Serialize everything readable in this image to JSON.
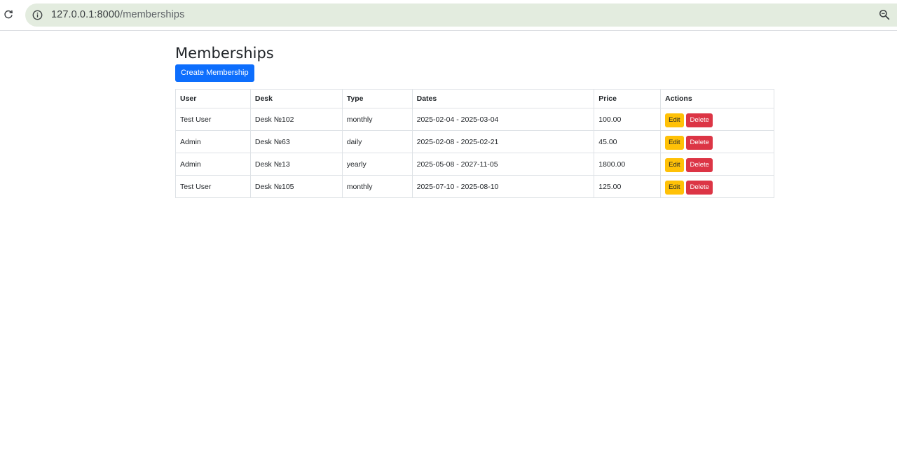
{
  "browser": {
    "url_host": "127.0.0.1:8000",
    "url_path": "/memberships"
  },
  "page": {
    "title": "Memberships",
    "create_label": "Create Membership"
  },
  "table": {
    "headers": [
      "User",
      "Desk",
      "Type",
      "Dates",
      "Price",
      "Actions"
    ],
    "rows": [
      {
        "user": "Test User",
        "desk": "Desk №102",
        "type": "monthly",
        "dates": "2025-02-04 - 2025-03-04",
        "price": "100.00"
      },
      {
        "user": "Admin",
        "desk": "Desk №63",
        "type": "daily",
        "dates": "2025-02-08 - 2025-02-21",
        "price": "45.00"
      },
      {
        "user": "Admin",
        "desk": "Desk №13",
        "type": "yearly",
        "dates": "2025-05-08 - 2027-11-05",
        "price": "1800.00"
      },
      {
        "user": "Test User",
        "desk": "Desk №105",
        "type": "monthly",
        "dates": "2025-07-10 - 2025-08-10",
        "price": "125.00"
      }
    ],
    "edit_label": "Edit",
    "delete_label": "Delete"
  },
  "colors": {
    "primary": "#0d6efd",
    "warning": "#ffc107",
    "danger": "#dc3545",
    "omnibox": "#e3ecdf"
  },
  "icons": {
    "reload": "reload-icon",
    "site_info": "info-icon",
    "zoom": "zoom-icon"
  }
}
